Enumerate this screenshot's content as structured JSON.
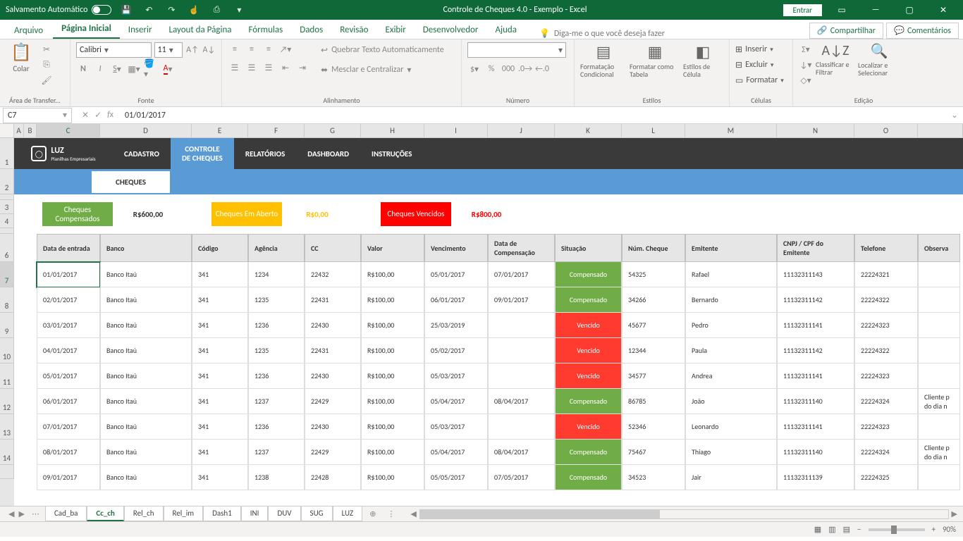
{
  "titlebar": {
    "autosave_label": "Salvamento Automático",
    "title": "Controle de Cheques 4.0 - Exemplo  -  Excel",
    "signin": "Entrar"
  },
  "ribbon": {
    "tabs": [
      "Arquivo",
      "Página Inicial",
      "Inserir",
      "Layout da Página",
      "Fórmulas",
      "Dados",
      "Revisão",
      "Exibir",
      "Desenvolvedor",
      "Ajuda"
    ],
    "tellme": "Diga-me o que você deseja fazer",
    "share": "Compartilhar",
    "comments": "Comentários",
    "groups": {
      "clipboard": "Área de Transfer...",
      "font": "Fonte",
      "alignment": "Alinhamento",
      "number": "Número",
      "styles": "Estilos",
      "cells": "Células",
      "editing": "Edição"
    },
    "font_name": "Calibri",
    "font_size": "11",
    "paste": "Colar",
    "wrap": "Quebrar Texto Automaticamente",
    "merge": "Mesclar e Centralizar",
    "cond_fmt": "Formatação Condicional",
    "fmt_table": "Formatar como Tabela",
    "cell_styles": "Estilos de Célula",
    "insert": "Inserir",
    "delete": "Excluir",
    "format": "Formatar",
    "sort": "Classificar e Filtrar",
    "find": "Localizar e Selecionar"
  },
  "formula_bar": {
    "ref": "C7",
    "value": "01/01/2017"
  },
  "columns": [
    "A",
    "B",
    "C",
    "D",
    "E",
    "F",
    "G",
    "H",
    "I",
    "J",
    "K",
    "L",
    "M",
    "N",
    "O"
  ],
  "row_numbers": [
    "",
    "1",
    "2",
    "",
    "3",
    "4",
    "",
    "6",
    "7",
    "8",
    "9",
    "10",
    "11",
    "12",
    "13",
    "14",
    ""
  ],
  "nav": {
    "items": [
      "CADASTRO",
      "CONTROLE DE CHEQUES",
      "RELATÓRIOS",
      "DASHBOARD",
      "INSTRUÇÕES"
    ],
    "logo": "LUZ",
    "logo_sub": "Planilhas Empresariais"
  },
  "cheques_tab": "CHEQUES",
  "summary": [
    {
      "label": "Cheques Compensados",
      "value": "R$600,00",
      "cls": "green-bg"
    },
    {
      "label": "Cheques Em Aberto",
      "value": "R$0,00",
      "cls": "yellow-bg",
      "valcolor": "#ffc000"
    },
    {
      "label": "Cheques Vencidos",
      "value": "R$800,00",
      "cls": "red-bg",
      "valcolor": "#ff0000"
    }
  ],
  "headers": [
    "Data de entrada",
    "Banco",
    "Código",
    "Agência",
    "CC",
    "Valor",
    "Vencimento",
    "Data de Compensação",
    "Situação",
    "Núm. Cheque",
    "Emitente",
    "CNPJ / CPF do Emitente",
    "Telefone",
    "Observa"
  ],
  "rows": [
    {
      "d": "01/01/2017",
      "b": "Banco Itaú",
      "cod": "341",
      "ag": "1234",
      "cc": "22432",
      "v": "R$100,00",
      "venc": "05/01/2017",
      "comp": "07/01/2017",
      "sit": "Compensado",
      "num": "54325",
      "em": "Rafael",
      "cpf": "11132311143",
      "tel": "22224321",
      "obs": ""
    },
    {
      "d": "02/01/2017",
      "b": "Banco Itaú",
      "cod": "341",
      "ag": "1235",
      "cc": "22431",
      "v": "R$100,00",
      "venc": "06/01/2017",
      "comp": "09/01/2017",
      "sit": "Compensado",
      "num": "34266",
      "em": "Bernardo",
      "cpf": "11132311142",
      "tel": "22224322",
      "obs": ""
    },
    {
      "d": "03/01/2017",
      "b": "Banco Itaú",
      "cod": "341",
      "ag": "1236",
      "cc": "22430",
      "v": "R$100,00",
      "venc": "25/03/2019",
      "comp": "",
      "sit": "Vencido",
      "num": "45677",
      "em": "Pedro",
      "cpf": "11132311141",
      "tel": "22224323",
      "obs": ""
    },
    {
      "d": "04/01/2017",
      "b": "Banco Itaú",
      "cod": "341",
      "ag": "1235",
      "cc": "22431",
      "v": "R$100,00",
      "venc": "05/02/2017",
      "comp": "",
      "sit": "Vencido",
      "num": "12344",
      "em": "Paula",
      "cpf": "11132311142",
      "tel": "22224322",
      "obs": ""
    },
    {
      "d": "05/01/2017",
      "b": "Banco Itaú",
      "cod": "341",
      "ag": "1236",
      "cc": "22430",
      "v": "R$100,00",
      "venc": "05/03/2017",
      "comp": "",
      "sit": "Vencido",
      "num": "34577",
      "em": "Andrea",
      "cpf": "11132311141",
      "tel": "22224323",
      "obs": ""
    },
    {
      "d": "06/01/2017",
      "b": "Banco Itaú",
      "cod": "341",
      "ag": "1237",
      "cc": "22429",
      "v": "R$100,00",
      "venc": "05/04/2017",
      "comp": "08/04/2017",
      "sit": "Compensado",
      "num": "86785",
      "em": "João",
      "cpf": "11132311140",
      "tel": "22224324",
      "obs": "Cliente p do dia n"
    },
    {
      "d": "07/01/2017",
      "b": "Banco Itaú",
      "cod": "341",
      "ag": "1236",
      "cc": "22430",
      "v": "R$100,00",
      "venc": "05/03/2017",
      "comp": "",
      "sit": "Vencido",
      "num": "52346",
      "em": "Leonardo",
      "cpf": "11132311141",
      "tel": "22224323",
      "obs": ""
    },
    {
      "d": "08/01/2017",
      "b": "Banco Itaú",
      "cod": "341",
      "ag": "1237",
      "cc": "22429",
      "v": "R$100,00",
      "venc": "05/04/2017",
      "comp": "08/04/2017",
      "sit": "Compensado",
      "num": "75467",
      "em": "Thiago",
      "cpf": "11132311140",
      "tel": "22224324",
      "obs": "Cliente p do dia n"
    },
    {
      "d": "09/01/2017",
      "b": "Banco Itaú",
      "cod": "341",
      "ag": "1238",
      "cc": "22428",
      "v": "R$100,00",
      "venc": "05/05/2017",
      "comp": "07/05/2017",
      "sit": "Compensado",
      "num": "34523",
      "em": "Jair",
      "cpf": "11132311139",
      "tel": "22224325",
      "obs": ""
    }
  ],
  "sheet_tabs": [
    "Cad_ba",
    "Cc_ch",
    "Rel_ch",
    "Rel_im",
    "Dash1",
    "INI",
    "DUV",
    "SUG",
    "LUZ"
  ],
  "zoom": "90%"
}
